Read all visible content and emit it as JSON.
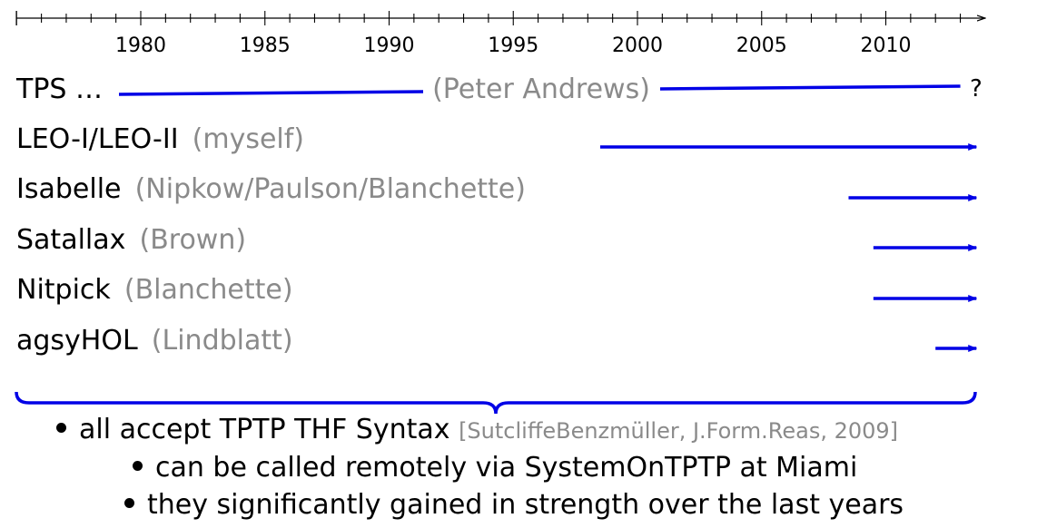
{
  "timeline": {
    "start_year": 1975,
    "end_year": 2013.5,
    "labeled_years": [
      "1980",
      "1985",
      "1990",
      "1995",
      "2000",
      "2005",
      "2010"
    ],
    "bar_color": "#0000e6"
  },
  "systems": [
    {
      "id": "tps",
      "name": "TPS …",
      "author": "(Peter Andrews)",
      "start_year": 1979,
      "end_year": 2013,
      "open_end_mark": "?"
    },
    {
      "id": "leo",
      "name": "LEO-I/LEO-II",
      "author": "(myself)",
      "start_year": 1998.5,
      "end_year": 2013.5,
      "arrow": true
    },
    {
      "id": "isabelle",
      "name": "Isabelle",
      "author": "(Nipkow/Paulson/Blanchette)",
      "start_year": 2008.5,
      "end_year": 2013.5,
      "arrow": true
    },
    {
      "id": "satallax",
      "name": "Satallax",
      "author": "(Brown)",
      "start_year": 2009.5,
      "end_year": 2013.5,
      "arrow": true
    },
    {
      "id": "nitpick",
      "name": "Nitpick",
      "author": "(Blanchette)",
      "start_year": 2009.5,
      "end_year": 2013.5,
      "arrow": true
    },
    {
      "id": "agsyhol",
      "name": "agsyHOL",
      "author": "(Lindblatt)",
      "start_year": 2012,
      "end_year": 2013.5,
      "arrow": true
    }
  ],
  "bullets": [
    {
      "text": "all accept TPTP THF Syntax",
      "citation": "[SutcliffeBenzmüller, J.Form.Reas, 2009]"
    },
    {
      "text": "can be called remotely via SystemOnTPTP at Miami",
      "citation": ""
    },
    {
      "text": "they significantly gained in strength over the last years",
      "citation": ""
    }
  ]
}
